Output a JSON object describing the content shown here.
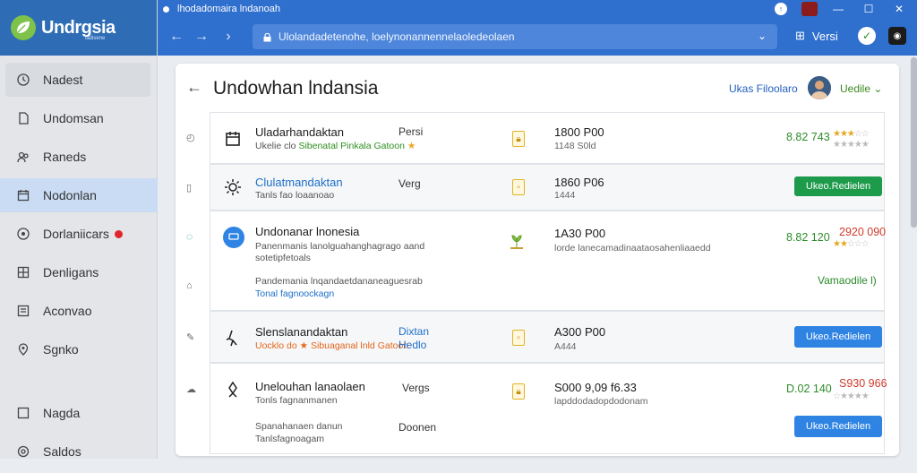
{
  "brand": {
    "name": "Undrgsia",
    "sub": "ladisene"
  },
  "sidebar": {
    "items": [
      {
        "label": "Nadest",
        "icon": "clock-icon"
      },
      {
        "label": "Undomsan",
        "icon": "document-icon"
      },
      {
        "label": "Raneds",
        "icon": "people-icon"
      },
      {
        "label": "Nodonlan",
        "icon": "calendar-icon"
      },
      {
        "label": "Dorlaniicars",
        "icon": "target-icon"
      },
      {
        "label": "Denligans",
        "icon": "grid-icon"
      },
      {
        "label": "Aconvao",
        "icon": "list-icon"
      },
      {
        "label": "Sgnko",
        "icon": "pin-icon"
      }
    ],
    "bottom": [
      {
        "label": "Nagda",
        "icon": "checkbox-icon"
      },
      {
        "label": "Saldos",
        "icon": "settings-icon"
      }
    ]
  },
  "browser": {
    "tab_title": "lhodadomaira lndanoah",
    "url": "Ulolandadetenohe, loelynonannennelaoledeolaen",
    "extension_label": "Versi"
  },
  "header": {
    "title": "Undowhan lndansia",
    "user_name": "Ukas Filoolaro",
    "user_menu": "Uedile"
  },
  "rows": [
    {
      "title": "Uladarhandaktan",
      "sub": "Ukelie clo",
      "sub_highlight": "Sibenatal Pinkala Gatoon",
      "col": "Persi",
      "price": "1800 P00",
      "price_sub": "1148 S0ld",
      "amount": "8.82 743",
      "stars": 3
    },
    {
      "title": "Clulatmandaktan",
      "sub": "Tanls fao loaanoao",
      "col": "Verg",
      "price": "1860 P06",
      "price_sub": "1444",
      "button": "Ukeo.Redielen"
    },
    {
      "title": "Undonanar lnonesia",
      "sub": "Panenmanis lanolguahanghagrago aand",
      "sub2": "sotetipfetoals",
      "sub3": "Pandemania lnqandaetdananeaguesrab",
      "link": "Tonal fagnoockagn",
      "price": "1A30 P00",
      "price_sub": "lorde lanecamadinaataosahenliaaedd",
      "amount": "8.82 120",
      "amount_red": "2920 090",
      "stars": 2,
      "action": "Vamaodile l)"
    },
    {
      "title": "Slenslanandaktan",
      "sub": "Uocklo do",
      "sub_highlight": "Sibuaganal lnld Gatoon",
      "col": "Dixtan",
      "col2": "Hedlo",
      "price": "A300 P00",
      "price_sub": "A444",
      "button": "Ukeo.Redielen"
    },
    {
      "title": "Unelouhan lanaolaen",
      "sub": "Tonls fagnanmanen",
      "sub2": "Spanahanaen danun",
      "sub3": "Tanlsfagnoagam",
      "col": "Vergs",
      "col2": "Doonen",
      "price": "S000 9,09 f6.33",
      "price_sub": "lapddodadopdodonam",
      "amount": "D.02 140",
      "amount_red": "S930 966",
      "stars": 0,
      "button": "Ukeo.Redielen"
    }
  ],
  "colors": {
    "topbar": "#2f6fce",
    "accent_green": "#2c8c29",
    "accent_blue": "#2f84e3",
    "active_nav": "#c9dcf4"
  }
}
